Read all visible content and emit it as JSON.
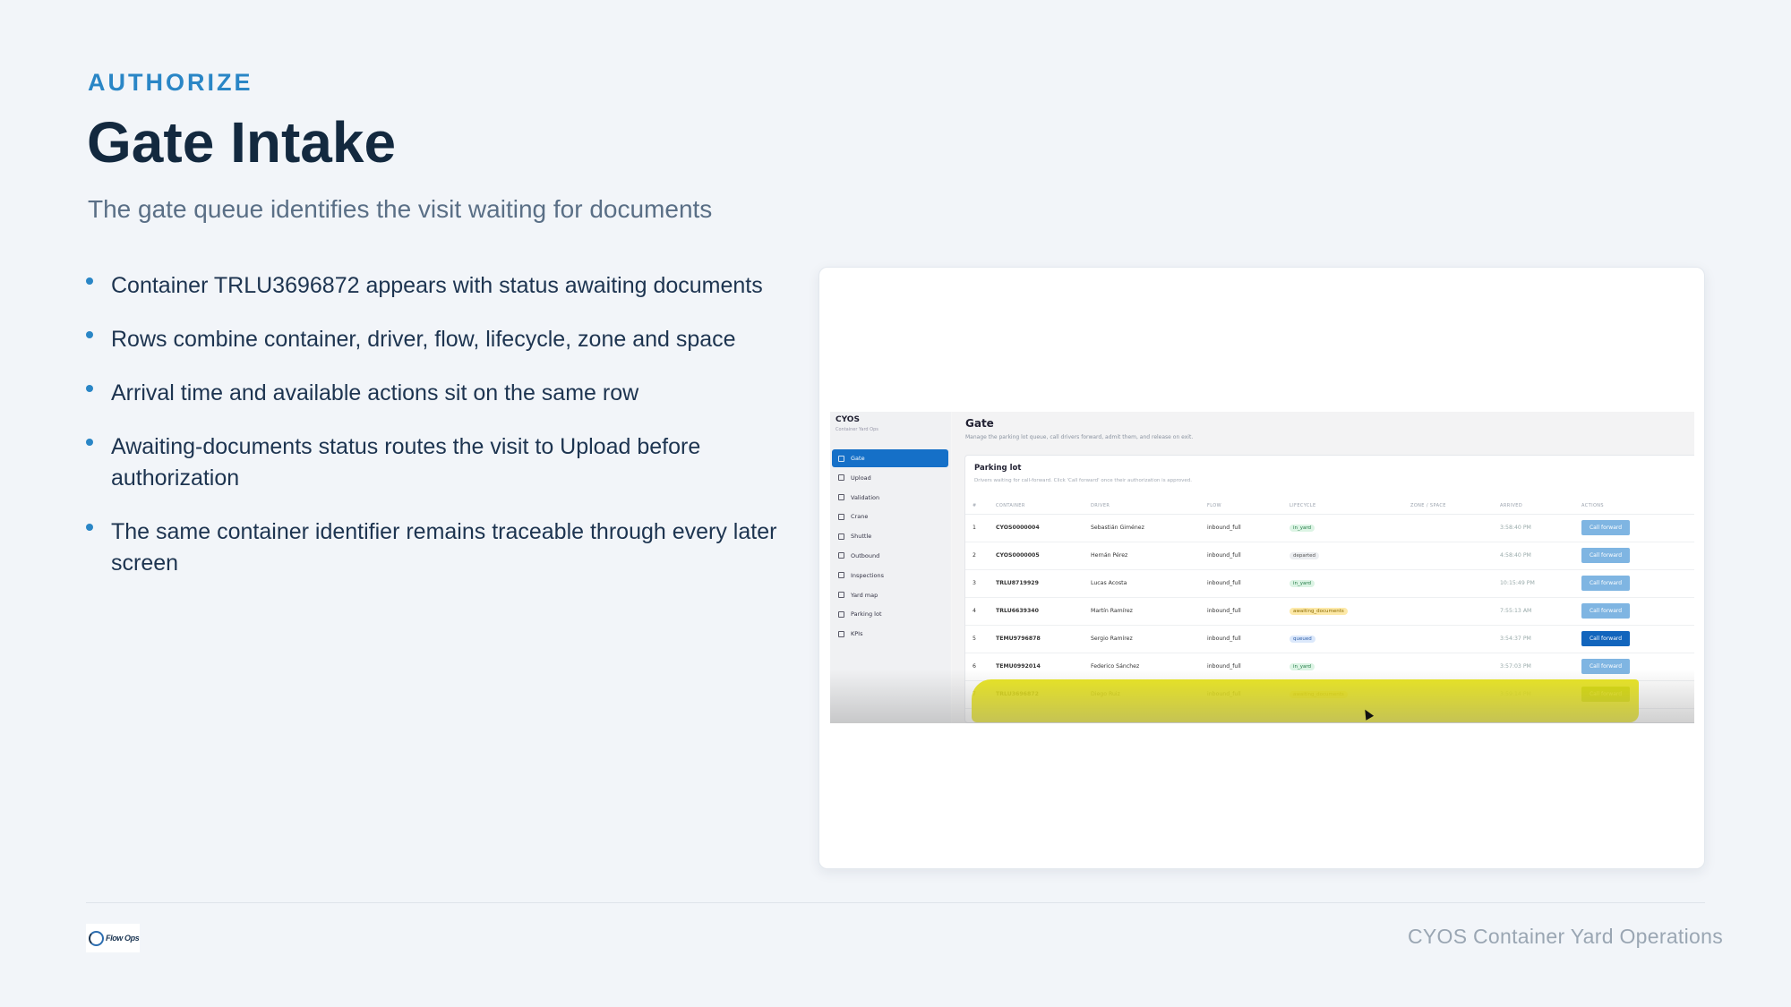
{
  "slide": {
    "kicker": "AUTHORIZE",
    "title": "Gate Intake",
    "subtitle": "The gate queue identifies the visit waiting for documents",
    "bullets": [
      "Container TRLU3696872 appears with status awaiting documents",
      "Rows combine container, driver, flow, lifecycle, zone and space",
      "Arrival time and available actions sit on the same row",
      "Awaiting-documents status routes the visit to Upload before authorization",
      "The same container identifier remains traceable through every later screen"
    ],
    "footer": "CYOS Container Yard Operations",
    "logo_text": "Flow Ops"
  },
  "app": {
    "brand": "CYOS",
    "brand_sub": "Container Yard Ops",
    "nav": [
      "Gate",
      "Upload",
      "Validation",
      "Crane",
      "Shuttle",
      "Outbound",
      "Inspections",
      "Yard map",
      "Parking lot",
      "KPIs"
    ],
    "page_title": "Gate",
    "page_sub": "Manage the parking lot queue, call drivers forward, admit them, and release on exit.",
    "panel_title": "Parking lot",
    "panel_sub": "Drivers waiting for call-forward. Click 'Call forward' once their authorization is approved.",
    "columns": [
      "#",
      "CONTAINER",
      "DRIVER",
      "FLOW",
      "LIFECYCLE",
      "ZONE / SPACE",
      "ARRIVED",
      "ACTIONS"
    ],
    "rows": [
      {
        "n": "1",
        "container": "CYOS0000004",
        "driver": "Sebastián Giménez",
        "flow": "inbound_full",
        "lifecycle": "in_yard",
        "zone": "",
        "arrived": "3:58:40 PM",
        "action": "Call forward"
      },
      {
        "n": "2",
        "container": "CYOS0000005",
        "driver": "Hernán Pérez",
        "flow": "inbound_full",
        "lifecycle": "departed",
        "zone": "",
        "arrived": "4:58:40 PM",
        "action": "Call forward"
      },
      {
        "n": "3",
        "container": "TRLU8719929",
        "driver": "Lucas Acosta",
        "flow": "inbound_full",
        "lifecycle": "in_yard",
        "zone": "",
        "arrived": "10:15:49 PM",
        "action": "Call forward"
      },
      {
        "n": "4",
        "container": "TRLU6639340",
        "driver": "Martín Ramírez",
        "flow": "inbound_full",
        "lifecycle": "awaiting_documents",
        "zone": "",
        "arrived": "7:55:13 AM",
        "action": "Call forward"
      },
      {
        "n": "5",
        "container": "TEMU9796878",
        "driver": "Sergio Ramírez",
        "flow": "inbound_full",
        "lifecycle": "queued",
        "zone": "",
        "arrived": "3:54:37 PM",
        "action": "Call forward"
      },
      {
        "n": "6",
        "container": "TEMU0992014",
        "driver": "Federico Sánchez",
        "flow": "inbound_full",
        "lifecycle": "in_yard",
        "zone": "",
        "arrived": "3:57:03 PM",
        "action": "Call forward"
      },
      {
        "n": "7",
        "container": "TRLU3696872",
        "driver": "Diego Ruiz",
        "flow": "inbound_full",
        "lifecycle": "awaiting_documents",
        "zone": "",
        "arrived": "3:59:14 PM",
        "action": "Call forward"
      }
    ]
  },
  "colors": {
    "accent": "#2a86c6",
    "title": "#13293f",
    "highlight": "#e8e400",
    "active_nav": "#1570c8"
  }
}
